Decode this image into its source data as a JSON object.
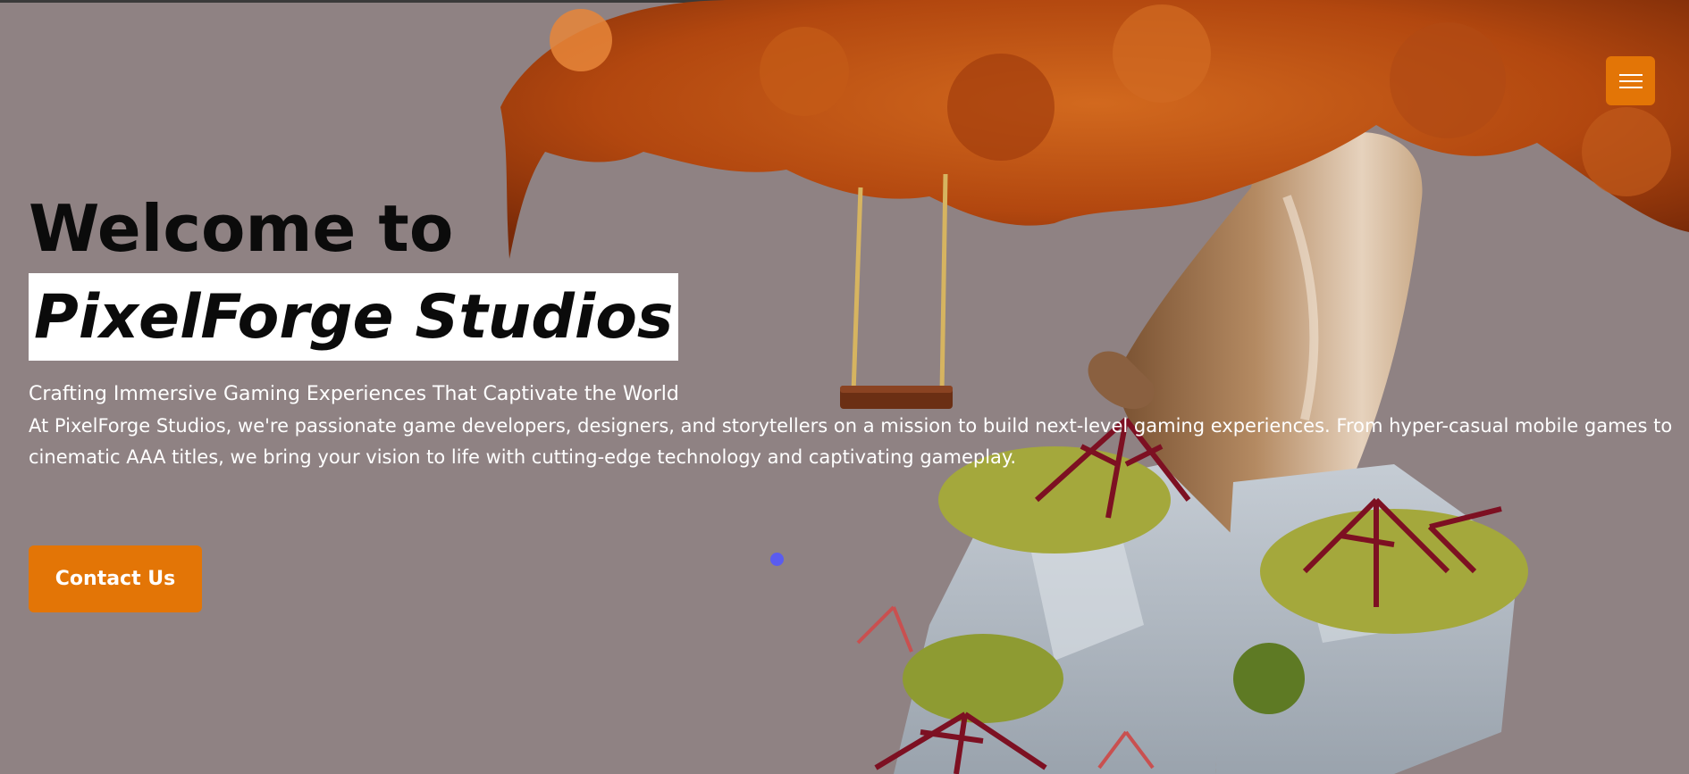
{
  "hero": {
    "welcome": "Welcome to",
    "brand": "PixelForge Studios",
    "tagline": "Crafting Immersive Gaming Experiences That Captivate the World",
    "description": "At PixelForge Studios, we're passionate game developers, designers, and storytellers on a mission to build next-level gaming experiences. From hyper-casual mobile games to cinematic AAA titles, we bring your vision to life with cutting-edge technology and captivating gameplay."
  },
  "buttons": {
    "contact": "Contact Us"
  },
  "icons": {
    "menu": "hamburger-menu-icon"
  },
  "colors": {
    "background": "#8f8283",
    "accent": "#e37506",
    "brand_highlight": "#ffffff",
    "cursor": "#5a5cf0"
  }
}
